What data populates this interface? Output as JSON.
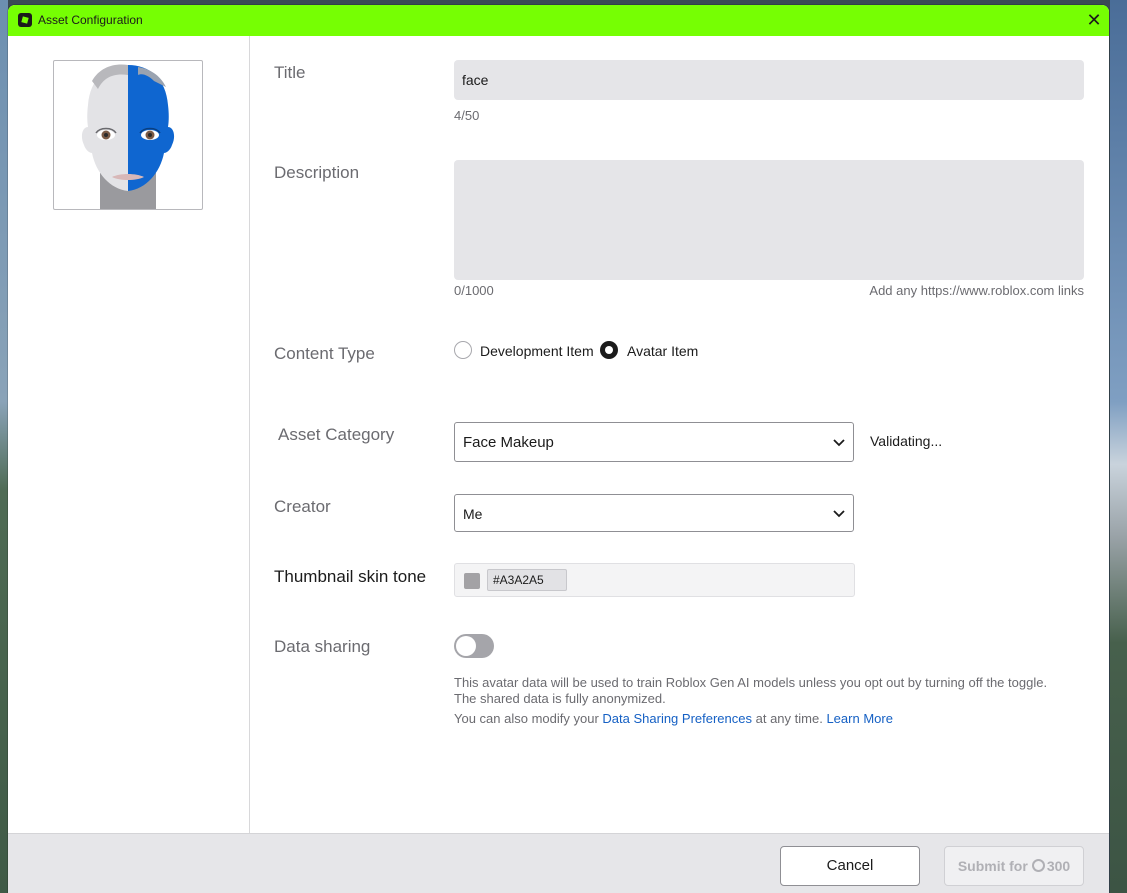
{
  "window": {
    "title": "Asset Configuration",
    "close_glyph": "✕",
    "titlebar_color": "#76ff03"
  },
  "form": {
    "title_label": "Title",
    "title_value": "face",
    "title_counter": "4/50",
    "description_label": "Description",
    "description_value": "",
    "description_counter": "0/1000",
    "description_hint": "Add any https://www.roblox.com links",
    "content_type_label": "Content Type",
    "content_type_options": [
      {
        "label": "Development Item",
        "selected": false
      },
      {
        "label": "Avatar Item",
        "selected": true
      }
    ],
    "asset_category_label": "Asset Category",
    "asset_category_value": "Face Makeup",
    "asset_category_status": "Validating...",
    "creator_label": "Creator",
    "creator_value": "Me",
    "skin_tone_label": "Thumbnail skin tone",
    "skin_tone_value": "#A3A2A5",
    "data_sharing_label": "Data sharing",
    "data_sharing_enabled": false,
    "data_sharing_line1": "This avatar data will be used to train Roblox Gen AI models unless you opt out by turning off the toggle.",
    "data_sharing_line2": "The shared data is fully anonymized.",
    "data_sharing_line3_prefix": "You can also modify your",
    "data_sharing_prefs_link": "Data Sharing Preferences",
    "data_sharing_line3_suffix": "at any time.",
    "learn_more_link": "Learn More"
  },
  "footer": {
    "cancel_label": "Cancel",
    "submit_label": "Submit for",
    "submit_price": "300",
    "currency_icon": "robux-icon"
  }
}
